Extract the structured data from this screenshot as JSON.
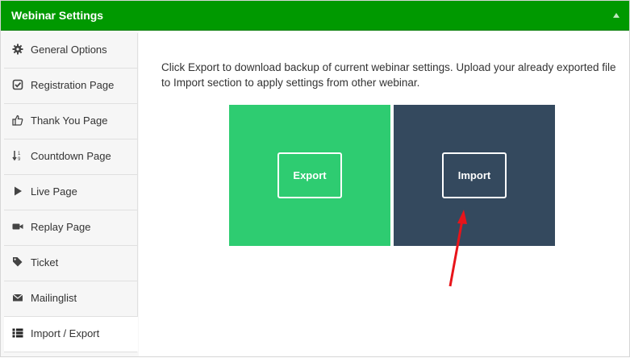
{
  "header": {
    "title": "Webinar Settings",
    "collapse_icon": "caret-up-icon"
  },
  "sidebar": {
    "items": [
      {
        "label": "General Options",
        "icon": "gear-icon"
      },
      {
        "label": "Registration Page",
        "icon": "check-square-icon"
      },
      {
        "label": "Thank You Page",
        "icon": "thumbs-up-icon"
      },
      {
        "label": "Countdown Page",
        "icon": "sort-icon"
      },
      {
        "label": "Live Page",
        "icon": "play-icon"
      },
      {
        "label": "Replay Page",
        "icon": "video-camera-icon"
      },
      {
        "label": "Ticket",
        "icon": "tags-icon"
      },
      {
        "label": "Mailinglist",
        "icon": "envelope-icon"
      },
      {
        "label": "Import / Export",
        "icon": "list-icon",
        "active": true
      }
    ]
  },
  "main": {
    "description": "Click Export to download backup of current webinar settings. Upload your already exported file to Import section to apply settings from other webinar.",
    "export_label": "Export",
    "import_label": "Import"
  },
  "colors": {
    "header_green": "#009900",
    "export_tile": "#2ecc71",
    "import_tile": "#34495e",
    "annotation_arrow": "#e8141a"
  }
}
